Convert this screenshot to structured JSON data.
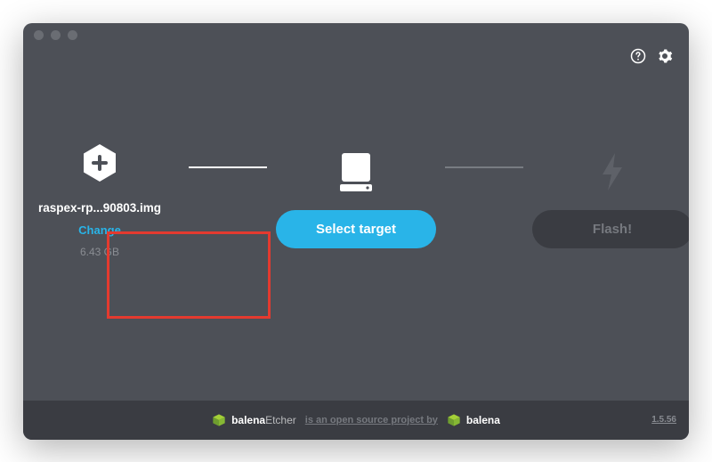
{
  "titlebar": {
    "dots": 3
  },
  "topright": {
    "help": "help-icon",
    "settings": "gear-icon"
  },
  "steps": {
    "image": {
      "filename": "raspex-rp...90803.img",
      "change_label": "Change",
      "filesize": "6.43 GB"
    },
    "target": {
      "button_label": "Select target"
    },
    "flash": {
      "button_label": "Flash!"
    }
  },
  "footer": {
    "brand1_a": "balena",
    "brand1_b": "Etcher",
    "tagline": "is an open source project by",
    "brand2": "balena",
    "version": "1.5.56"
  }
}
